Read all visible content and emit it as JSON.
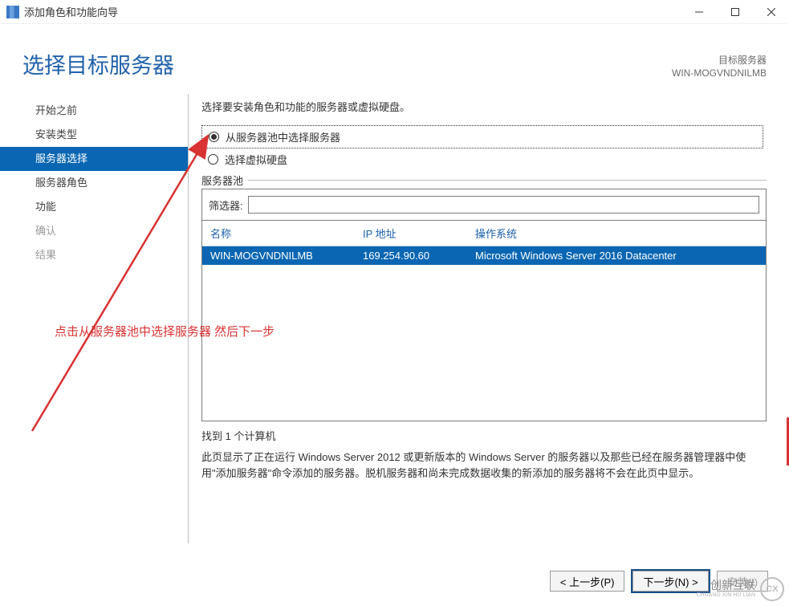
{
  "window": {
    "title": "添加角色和功能向导"
  },
  "heading": "选择目标服务器",
  "target": {
    "label": "目标服务器",
    "name": "WIN-MOGVNDNILMB"
  },
  "sidebar": {
    "items": [
      {
        "label": "开始之前",
        "state": "normal"
      },
      {
        "label": "安装类型",
        "state": "normal"
      },
      {
        "label": "服务器选择",
        "state": "selected"
      },
      {
        "label": "服务器角色",
        "state": "normal"
      },
      {
        "label": "功能",
        "state": "normal"
      },
      {
        "label": "确认",
        "state": "disabled"
      },
      {
        "label": "结果",
        "state": "disabled"
      }
    ]
  },
  "content": {
    "instruction": "选择要安装角色和功能的服务器或虚拟硬盘。",
    "radio1": "从服务器池中选择服务器",
    "radio2": "选择虚拟硬盘",
    "pool_title": "服务器池",
    "filter_label": "筛选器:",
    "filter_value": "",
    "columns": {
      "name": "名称",
      "ip": "IP 地址",
      "os": "操作系统"
    },
    "rows": [
      {
        "name": "WIN-MOGVNDNILMB",
        "ip": "169.254.90.60",
        "os": "Microsoft Windows Server 2016 Datacenter"
      }
    ],
    "found": "找到 1 个计算机",
    "description": "此页显示了正在运行 Windows Server 2012 或更新版本的 Windows Server 的服务器以及那些已经在服务器管理器中使用\"添加服务器\"命令添加的服务器。脱机服务器和尚未完成数据收集的新添加的服务器将不会在此页中显示。"
  },
  "annotation": "点击从服务器池中选择服务器  然后下一步",
  "buttons": {
    "prev": "< 上一步(P)",
    "next": "下一步(N) >",
    "install": "安装(I)"
  },
  "watermark": {
    "line1": "创新互联",
    "line2": "CHUANG XIN HU LIAN",
    "badge": "CX"
  }
}
